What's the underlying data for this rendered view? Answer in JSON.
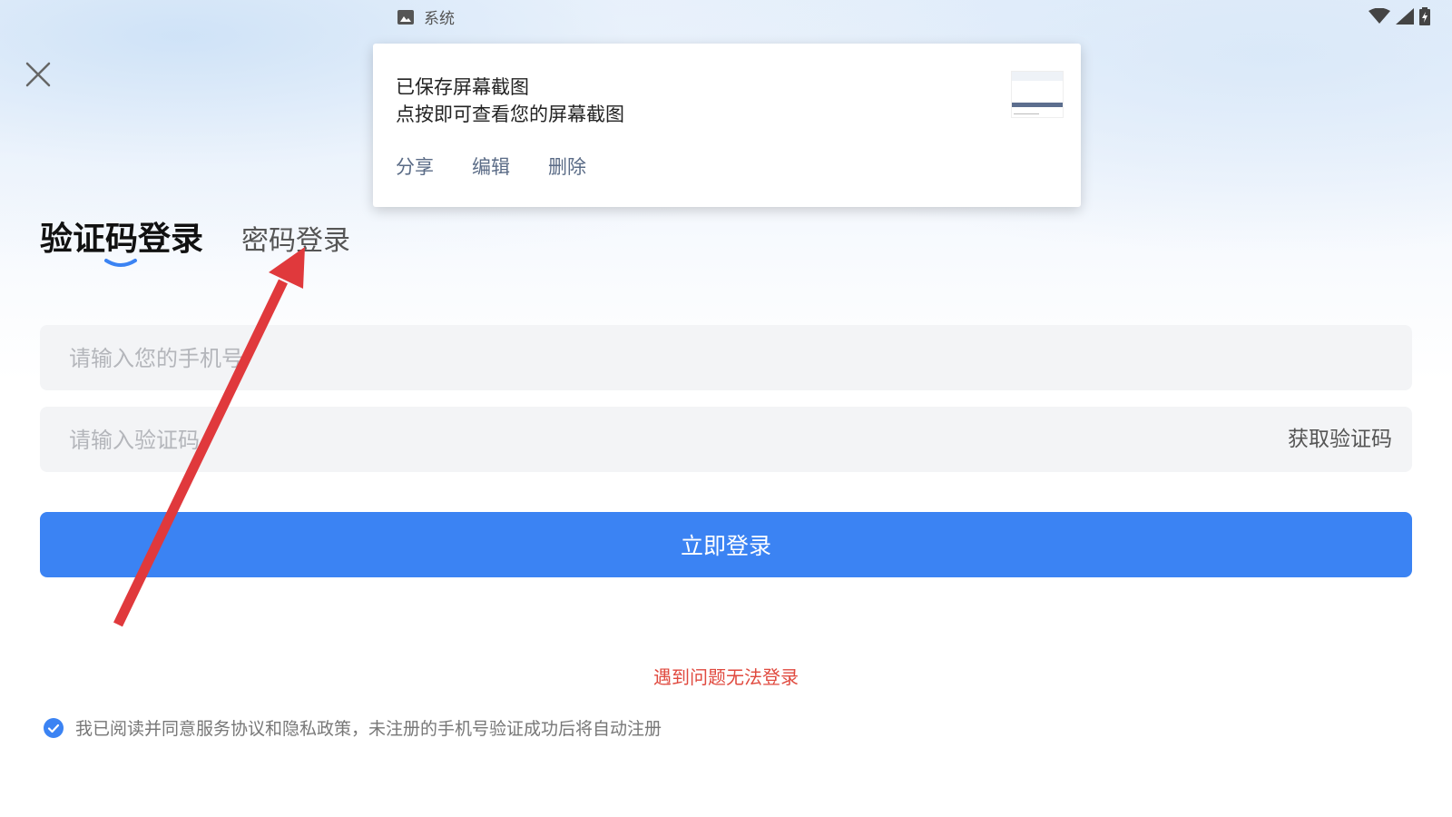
{
  "status_bar": {
    "app_icon": "image-icon",
    "app_label": "系统",
    "icons": [
      "wifi-icon",
      "signal-icon",
      "battery-icon"
    ]
  },
  "close_icon": "close-icon",
  "tabs": {
    "active_label": "验证码登录",
    "inactive_label": "密码登录"
  },
  "phone_field": {
    "placeholder": "请输入您的手机号",
    "value": ""
  },
  "code_field": {
    "placeholder": "请输入验证码",
    "value": "",
    "get_code_label": "获取验证码"
  },
  "login_button": {
    "label": "立即登录"
  },
  "trouble_link": "遇到问题无法登录",
  "agreement": {
    "checked": true,
    "text": "我已阅读并同意服务协议和隐私政策，未注册的手机号验证成功后将自动注册"
  },
  "screenshot_toast": {
    "title": "已保存屏幕截图",
    "subtitle": "点按即可查看您的屏幕截图",
    "actions": [
      "分享",
      "编辑",
      "删除"
    ]
  },
  "colors": {
    "primary": "#3b83f3",
    "warning_text": "#e04a3f",
    "annotation_arrow": "#e0393c"
  }
}
